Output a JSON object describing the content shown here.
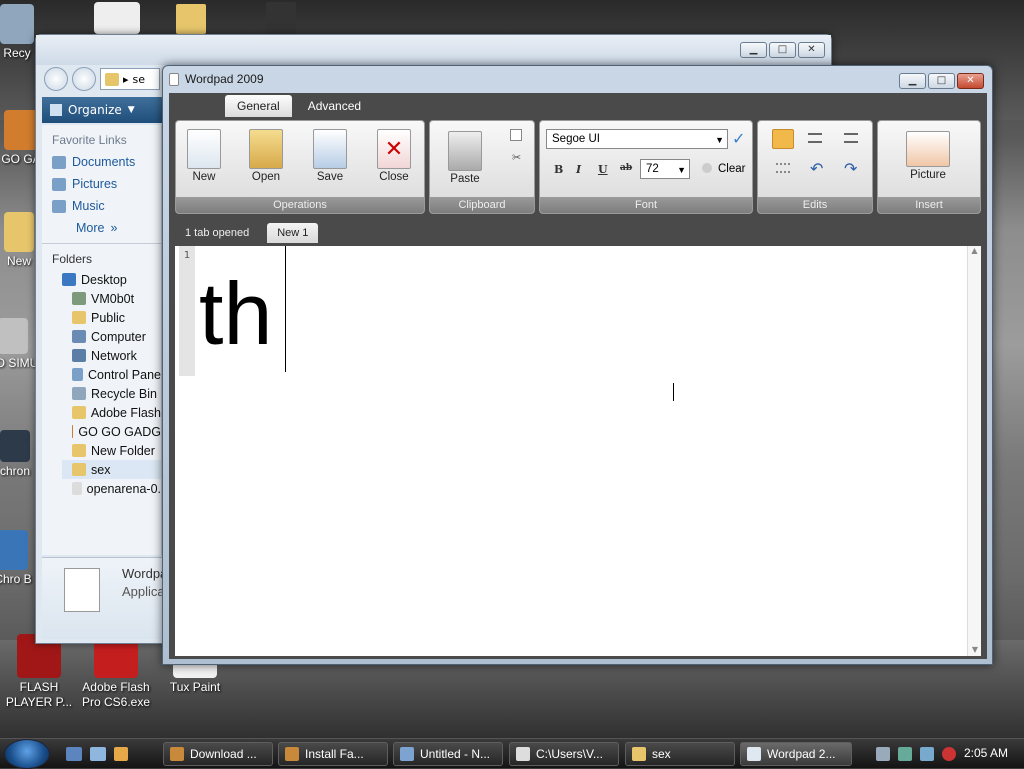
{
  "desktop_icons": [
    {
      "label": "Recy",
      "color": "#8fa6bd"
    },
    {
      "label": "GO GA",
      "color": "#d27d2d"
    },
    {
      "label": "New",
      "color": "#e7c66b"
    },
    {
      "label": "BO SIMU",
      "color": "#c0c0c0"
    },
    {
      "label": "chron",
      "color": "#2d3a4a"
    },
    {
      "label": "Chro B",
      "color": "#3a75b7"
    },
    {
      "label": "FLASH PLAYER P...",
      "color": "#a11717"
    },
    {
      "label": "Adobe Flash Pro CS6.exe",
      "color": "#c41e1e"
    },
    {
      "label": "Tux Paint",
      "color": "#f2f2f2"
    }
  ],
  "explorer": {
    "addr": "se",
    "toolbar": {
      "organize": "Organize"
    },
    "favorite_links_header": "Favorite Links",
    "favorites": [
      "Documents",
      "Pictures",
      "Music"
    ],
    "more": "More",
    "folders_header": "Folders",
    "tree": [
      {
        "label": "Desktop",
        "color": "#3a78c2",
        "indent": 0
      },
      {
        "label": "VM0b0t",
        "color": "#7d9a7a",
        "indent": 1
      },
      {
        "label": "Public",
        "color": "#e7c66b",
        "indent": 1
      },
      {
        "label": "Computer",
        "color": "#6a8cb4",
        "indent": 1
      },
      {
        "label": "Network",
        "color": "#5a7ea6",
        "indent": 1
      },
      {
        "label": "Control Pane",
        "color": "#7aa0c8",
        "indent": 1
      },
      {
        "label": "Recycle Bin",
        "color": "#8fa6bd",
        "indent": 1
      },
      {
        "label": "Adobe Flash",
        "color": "#e7c66b",
        "indent": 1
      },
      {
        "label": "GO GO GADG",
        "color": "#d27d2d",
        "indent": 1
      },
      {
        "label": "New Folder",
        "color": "#e7c66b",
        "indent": 1
      },
      {
        "label": "sex",
        "color": "#e7c66b",
        "indent": 1
      },
      {
        "label": "openarena-0.",
        "color": "#dcdcdc",
        "indent": 1
      }
    ],
    "details": {
      "name": "Wordpad",
      "type": "Applica"
    }
  },
  "wordpad": {
    "title": "Wordpad 2009",
    "tabs": [
      "General",
      "Advanced"
    ],
    "groups": {
      "operations": {
        "label": "Operations",
        "new": "New",
        "open": "Open",
        "save": "Save",
        "close": "Close"
      },
      "clipboard": {
        "label": "Clipboard",
        "paste": "Paste"
      },
      "font": {
        "label": "Font",
        "font_name": "Segoe UI",
        "font_size": "72",
        "bold": "B",
        "italic": "I",
        "underline": "U",
        "strike": "ab",
        "clear": "Clear"
      },
      "edits": {
        "label": "Edits"
      },
      "insert": {
        "label": "Insert",
        "picture": "Picture"
      }
    },
    "tabs_opened": "1 tab opened",
    "doc_tab": "New 1",
    "line_number": "1",
    "document_text": "th"
  },
  "taskbar": {
    "items": [
      {
        "label": "Download ...",
        "color": "#c88a3a",
        "active": false
      },
      {
        "label": "Install Fa...",
        "color": "#c88a3a",
        "active": false
      },
      {
        "label": "Untitled - N...",
        "color": "#7da4d0",
        "active": false
      },
      {
        "label": "C:\\Users\\V...",
        "color": "#dddddd",
        "active": false
      },
      {
        "label": "sex",
        "color": "#e7c66b",
        "active": false
      },
      {
        "label": "Wordpad 2...",
        "color": "#dfe8f1",
        "active": true
      }
    ],
    "clock": "2:05 AM"
  }
}
